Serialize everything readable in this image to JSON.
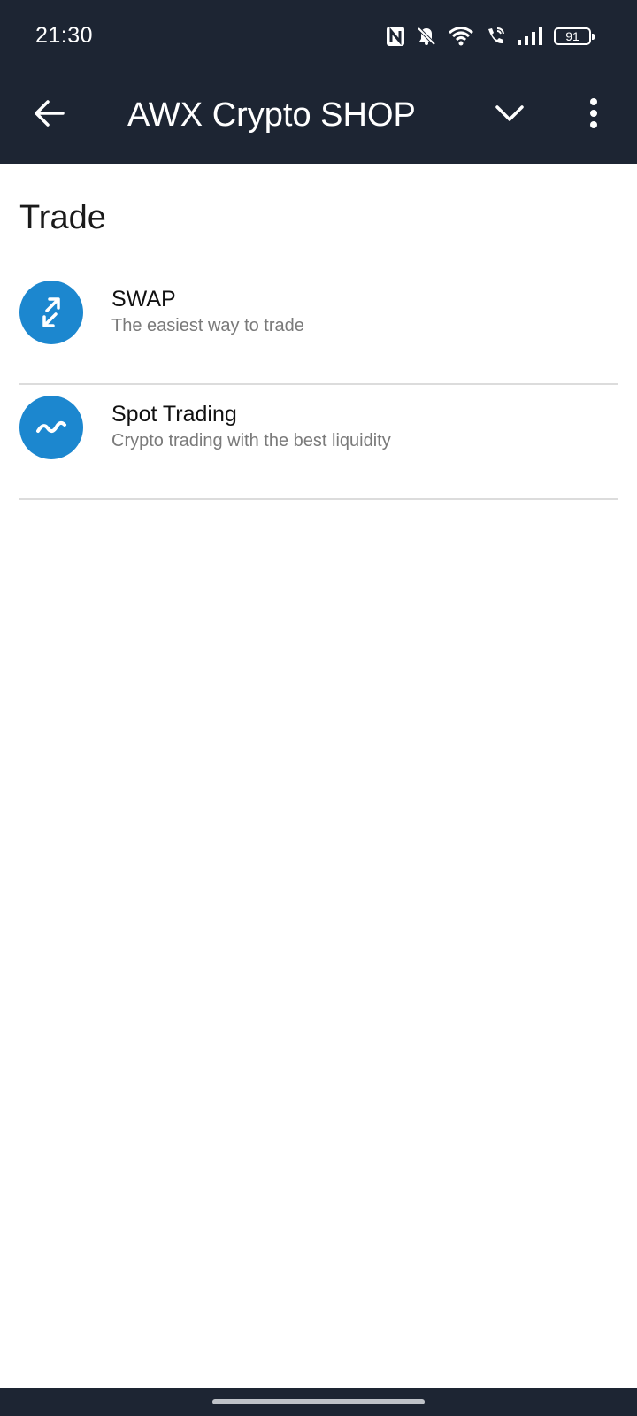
{
  "status_bar": {
    "time": "21:30",
    "battery_level": "91",
    "icons": [
      "nfc-icon",
      "bell-off-icon",
      "wifi-icon",
      "wifi-call-icon",
      "signal-icon",
      "battery-icon"
    ]
  },
  "app_bar": {
    "title": "AWX Crypto SHOP",
    "back_icon": "arrow-left-icon",
    "dropdown_icon": "chevron-down-icon",
    "menu_icon": "more-vertical-icon"
  },
  "content": {
    "section_title": "Trade",
    "items": [
      {
        "title": "SWAP",
        "subtitle": "The easiest way to trade",
        "icon": "swap-arrows-icon"
      },
      {
        "title": "Spot Trading",
        "subtitle": "Crypto trading with the best liquidity",
        "icon": "trend-wave-icon"
      }
    ]
  },
  "colors": {
    "header_bg": "#1d2533",
    "accent": "#1c87cf",
    "divider": "#dcdcdc",
    "subtitle_text": "#7a7a7a"
  }
}
